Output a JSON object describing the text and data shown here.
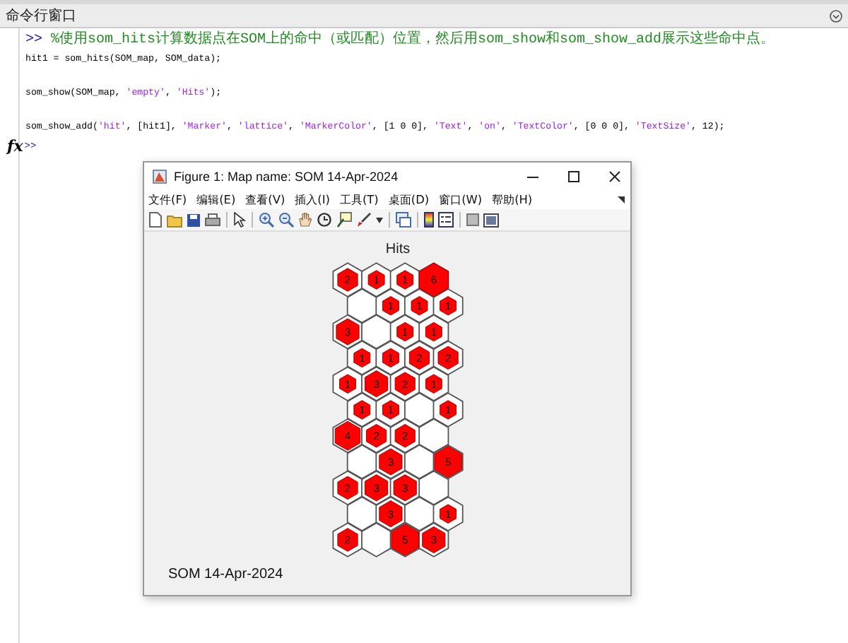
{
  "command_window": {
    "title": "命令行窗口",
    "lines": [
      {
        "gap_before": false,
        "tokens": [
          {
            "kind": "prompt",
            "text": ">> "
          },
          {
            "kind": "comment",
            "text": "%使用som_hits计算数据点在SOM上的命中（或匹配）位置，然后用som_show和som_show_add展示这些命中点。"
          }
        ]
      },
      {
        "gap_before": false,
        "tokens": [
          {
            "kind": "code",
            "text": "hit1 = som_hits(SOM_map, SOM_data);"
          }
        ]
      },
      {
        "gap_before": true,
        "tokens": [
          {
            "kind": "code",
            "text": "som_show(SOM_map, "
          },
          {
            "kind": "string",
            "text": "'empty'"
          },
          {
            "kind": "code",
            "text": ", "
          },
          {
            "kind": "string",
            "text": "'Hits'"
          },
          {
            "kind": "code",
            "text": ");"
          }
        ]
      },
      {
        "gap_before": true,
        "tokens": [
          {
            "kind": "code",
            "text": "som_show_add("
          },
          {
            "kind": "string",
            "text": "'hit'"
          },
          {
            "kind": "code",
            "text": ", [hit1], "
          },
          {
            "kind": "string",
            "text": "'Marker'"
          },
          {
            "kind": "code",
            "text": ", "
          },
          {
            "kind": "string",
            "text": "'lattice'"
          },
          {
            "kind": "code",
            "text": ", "
          },
          {
            "kind": "string",
            "text": "'MarkerColor'"
          },
          {
            "kind": "code",
            "text": ", [1 0 0], "
          },
          {
            "kind": "string",
            "text": "'Text'"
          },
          {
            "kind": "code",
            "text": ", "
          },
          {
            "kind": "string",
            "text": "'on'"
          },
          {
            "kind": "code",
            "text": ", "
          },
          {
            "kind": "string",
            "text": "'TextColor'"
          },
          {
            "kind": "code",
            "text": ", [0 0 0], "
          },
          {
            "kind": "string",
            "text": "'TextSize'"
          },
          {
            "kind": "code",
            "text": ", 12);"
          }
        ]
      }
    ],
    "function_icon": "fx",
    "prompt": ">>"
  },
  "figure": {
    "title": "Figure 1: Map name: SOM 14-Apr-2024",
    "menus": [
      "文件(F)",
      "编辑(E)",
      "查看(V)",
      "插入(I)",
      "工具(T)",
      "桌面(D)",
      "窗口(W)",
      "帮助(H)"
    ],
    "plot_title": "Hits",
    "lattice_rows": [
      [
        "2",
        "1",
        "1",
        "6"
      ],
      [
        null,
        "1",
        "1",
        "1"
      ],
      [
        "3",
        null,
        "1",
        "1"
      ],
      [
        "1",
        "1",
        "2",
        "2"
      ],
      [
        "1",
        "3",
        "2",
        "1"
      ],
      [
        "1",
        "1",
        null,
        "1"
      ],
      [
        "4",
        "2",
        "2",
        null
      ],
      [
        null,
        "3",
        null,
        "5"
      ],
      [
        "2",
        "3",
        "3",
        null
      ],
      [
        null,
        "3",
        null,
        "1"
      ],
      [
        "2",
        null,
        "5",
        "3"
      ]
    ],
    "footer": "SOM 14-Apr-2024"
  }
}
